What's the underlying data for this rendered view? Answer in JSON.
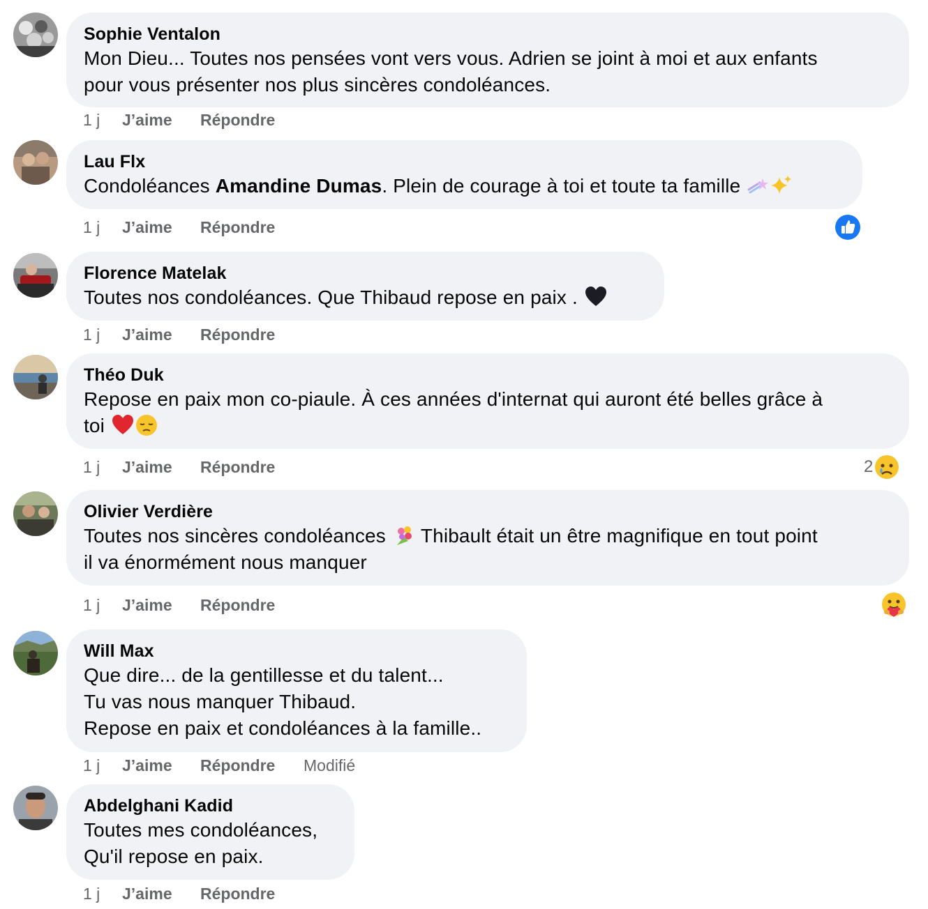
{
  "actions": {
    "time": "1 j",
    "like": "J’aime",
    "reply": "Répondre",
    "edited": "Modifié"
  },
  "comments": [
    {
      "author": "Sophie Ventalon",
      "text": "Mon Dieu... Toutes nos pensées vont vers vous. Adrien se joint à moi et aux enfants\npour vous présenter nos plus sincères condoléances."
    },
    {
      "author": "Lau Flx",
      "text_before": "Condoléances ",
      "mention": "Amandine Dumas",
      "text_after": ". Plein de courage à toi et toute ta famille",
      "emojis": [
        "shooting-star-emoji",
        "sparkles-emoji"
      ],
      "reaction": {
        "icon": "like-reaction-icon",
        "color": "#1877f2"
      }
    },
    {
      "author": "Florence Matelak",
      "text": "Toutes nos condoléances. Que Thibaud repose en paix .",
      "emojis": [
        "black-heart-emoji"
      ]
    },
    {
      "author": "Théo Duk",
      "text": "Repose en paix mon co-piaule. À ces années d'internat qui auront été belles grâce à\ntoi",
      "emojis": [
        "red-heart-emoji",
        "pensive-face-emoji"
      ],
      "reaction": {
        "icon": "sad-reaction-icon",
        "count": "2"
      }
    },
    {
      "author": "Olivier Verdière",
      "text_before": "Toutes nos sincères condoléances",
      "emojis": [
        "bouquet-emoji"
      ],
      "text_after": "Thibault était un être magnifique en tout point\nil va énormément nous manquer",
      "reaction": {
        "icon": "care-reaction-icon"
      }
    },
    {
      "author": "Will Max",
      "text": "Que dire... de la gentillesse et du talent...\nTu vas nous manquer Thibaud.\nRepose en paix et condoléances à la famille..",
      "edited": true
    },
    {
      "author": "Abdelghani Kadid",
      "text": "Toutes mes condoléances,\nQu'il repose en paix."
    }
  ],
  "colors": {
    "bubble": "#f0f2f5",
    "meta_text": "#65676b",
    "like_blue": "#1877f2"
  }
}
